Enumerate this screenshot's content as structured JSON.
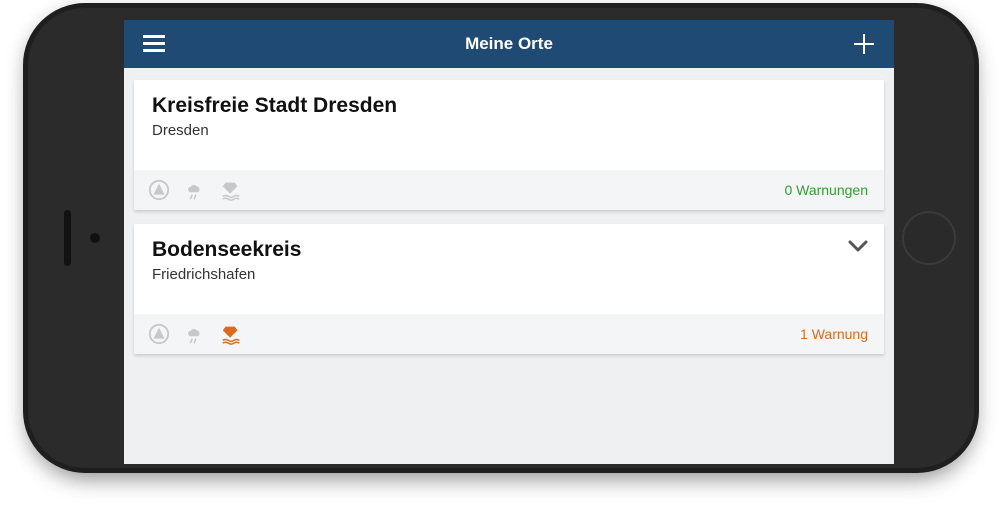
{
  "header": {
    "title": "Meine Orte"
  },
  "places": {
    "0": {
      "title": "Kreisfreie Stadt Dresden",
      "subtitle": "Dresden",
      "warning_text": "0 Warnungen"
    },
    "1": {
      "title": "Bodenseekreis",
      "subtitle": "Friedrichshafen",
      "warning_text": "1 Warnung"
    }
  }
}
